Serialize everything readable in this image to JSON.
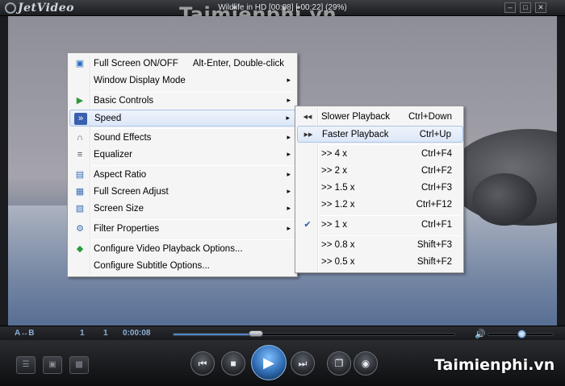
{
  "app": {
    "logo": "JetVideo",
    "window_title": "Wildlife in HD [00:08] [-00:22] (29%)",
    "watermark": "Taimienphi.vn"
  },
  "window_controls": {
    "minimize": "–",
    "maximize": "□",
    "close": "✕"
  },
  "menu": {
    "items": [
      {
        "label": "Full Screen ON/OFF",
        "shortcut": "Alt-Enter, Double-click",
        "icon": "fullscreen-icon",
        "glyph": "▣"
      },
      {
        "label": "Window Display Mode",
        "shortcut": "",
        "icon": "",
        "glyph": "",
        "arrow": "▸"
      },
      {
        "label": "Basic Controls",
        "shortcut": "",
        "icon": "basic-controls-icon",
        "glyph": "▶",
        "arrow": "▸"
      },
      {
        "label": "Speed",
        "shortcut": "",
        "icon": "speed-icon",
        "glyph": "»",
        "arrow": "▸"
      },
      {
        "label": "Sound Effects",
        "shortcut": "",
        "icon": "headphones-icon",
        "glyph": "∩",
        "arrow": "▸"
      },
      {
        "label": "Equalizer",
        "shortcut": "",
        "icon": "equalizer-icon",
        "glyph": "≡",
        "arrow": "▸"
      },
      {
        "label": "Aspect Ratio",
        "shortcut": "",
        "icon": "aspect-ratio-icon",
        "glyph": "▤",
        "arrow": "▸"
      },
      {
        "label": "Full Screen Adjust",
        "shortcut": "",
        "icon": "fullscreen-adjust-icon",
        "glyph": "▦",
        "arrow": "▸"
      },
      {
        "label": "Screen Size",
        "shortcut": "",
        "icon": "screen-size-icon",
        "glyph": "▧",
        "arrow": "▸"
      },
      {
        "label": "Filter Properties",
        "shortcut": "",
        "icon": "filter-icon",
        "glyph": "⚙",
        "arrow": "▸"
      },
      {
        "label": "Configure Video Playback Options...",
        "shortcut": "",
        "icon": "configure-icon",
        "glyph": "◆"
      },
      {
        "label": "Configure Subtitle Options...",
        "shortcut": "",
        "icon": "",
        "glyph": ""
      }
    ]
  },
  "speed_menu": {
    "items": [
      {
        "label": "Slower Playback",
        "shortcut": "Ctrl+Down",
        "glyph": "◀◀"
      },
      {
        "label": "Faster Playback",
        "shortcut": "Ctrl+Up",
        "glyph": "▶▶"
      },
      {
        "label": ">> 4 x",
        "shortcut": "Ctrl+F4",
        "glyph": ""
      },
      {
        "label": ">> 2 x",
        "shortcut": "Ctrl+F2",
        "glyph": ""
      },
      {
        "label": ">> 1.5 x",
        "shortcut": "Ctrl+F3",
        "glyph": ""
      },
      {
        "label": ">> 1.2 x",
        "shortcut": "Ctrl+F12",
        "glyph": ""
      },
      {
        "label": ">> 1 x",
        "shortcut": "Ctrl+F1",
        "glyph": "✔"
      },
      {
        "label": ">> 0.8 x",
        "shortcut": "Shift+F3",
        "glyph": ""
      },
      {
        "label": ">> 0.5 x",
        "shortcut": "Shift+F2",
        "glyph": ""
      }
    ]
  },
  "status": {
    "ab": "A↔B",
    "chapter": "1",
    "title_no": "1",
    "time": "0:00:08",
    "progress_fraction": 0.29,
    "volume_fraction": 0.5
  },
  "controls": {
    "prev": "⏮",
    "stop": "■",
    "play": "▶",
    "next": "⏭",
    "open": "❐",
    "record": "◉"
  }
}
